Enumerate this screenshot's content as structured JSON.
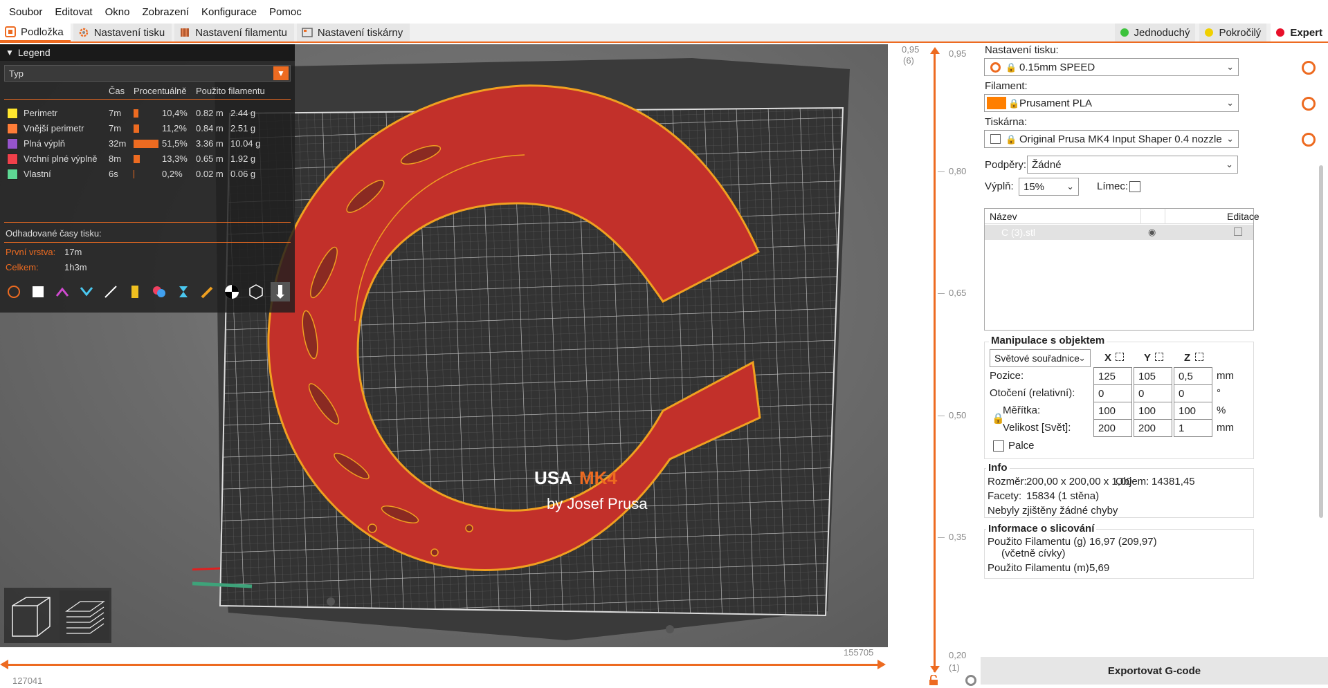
{
  "menu": [
    "Soubor",
    "Editovat",
    "Okno",
    "Zobrazení",
    "Konfigurace",
    "Pomoc"
  ],
  "tabs": [
    {
      "label": "Podložka",
      "icon": "plater-icon"
    },
    {
      "label": "Nastavení tisku",
      "icon": "gear-icon"
    },
    {
      "label": "Nastavení filamentu",
      "icon": "spool-icon"
    },
    {
      "label": "Nastavení tiskárny",
      "icon": "printer-icon"
    }
  ],
  "modes": [
    {
      "label": "Jednoduchý",
      "color": "#3cc23c"
    },
    {
      "label": "Pokročilý",
      "color": "#f0d000"
    },
    {
      "label": "Expert",
      "color": "#e8102a"
    }
  ],
  "legend": {
    "title": "Legend",
    "view_type": "Typ",
    "col_time": "Čas",
    "col_percent": "Procentuálně",
    "col_used": "Použito filamentu",
    "rows": [
      {
        "name": "Perimetr",
        "color": "#ffe62e",
        "time": "7m",
        "percent": "10,4%",
        "pct_value": 10.4,
        "m": "0.82 m",
        "g": "2.44 g"
      },
      {
        "name": "Vnější perimetr",
        "color": "#ff7d38",
        "time": "7m",
        "percent": "11,2%",
        "pct_value": 11.2,
        "m": "0.84 m",
        "g": "2.51 g"
      },
      {
        "name": "Plná výplň",
        "color": "#9654cc",
        "time": "32m",
        "percent": "51,5%",
        "pct_value": 51.5,
        "m": "3.36 m",
        "g": "10.04 g"
      },
      {
        "name": "Vrchní plné výplně",
        "color": "#f0404a",
        "time": "8m",
        "percent": "13,3%",
        "pct_value": 13.3,
        "m": "0.65 m",
        "g": "1.92 g"
      },
      {
        "name": "Vlastní",
        "color": "#5ed894",
        "time": "6s",
        "percent": "0,2%",
        "pct_value": 0.2,
        "m": "0.02 m",
        "g": "0.06 g"
      }
    ],
    "est_label": "Odhadované časy tisku:",
    "first_layer_label": "První vrstva:",
    "first_layer_value": "17m",
    "total_label": "Celkem:",
    "total_value": "1h3m"
  },
  "bed_text": {
    "brand_part": "USA",
    "model": "MK4",
    "by": "by Josef Prusa"
  },
  "hslider": {
    "left_value": "127041",
    "right_value": "155705"
  },
  "vslider": {
    "top_value": "0,95",
    "top_layer": "(6)",
    "top_label": "0,95",
    "ticks": [
      "0,80",
      "0,65",
      "0,50",
      "0,35"
    ],
    "bottom_value": "0,20",
    "bottom_layer": "(1)"
  },
  "sidebar": {
    "print_label": "Nastavení tisku:",
    "print_value": "0.15mm SPEED",
    "filament_label": "Filament:",
    "filament_value": "Prusament PLA",
    "filament_color": "#ff7f00",
    "printer_label": "Tiskárna:",
    "printer_value": "Original Prusa MK4 Input Shaper 0.4 nozzle",
    "supports_label": "Podpěry:",
    "supports_value": "Žádné",
    "infill_label": "Výplň:",
    "infill_value": "15%",
    "brim_label": "Límec:",
    "objlist_col_name": "Název",
    "objlist_col_edit": "Editace",
    "object_name": "C (3).stl",
    "manip_title": "Manipulace s objektem",
    "coord_value": "Světové souřadnice",
    "axis_x": "X",
    "axis_y": "Y",
    "axis_z": "Z",
    "pos_label": "Pozice:",
    "pos": [
      "125",
      "105",
      "0,5"
    ],
    "pos_unit": "mm",
    "rot_label": "Otočení (relativní):",
    "rot": [
      "0",
      "0",
      "0"
    ],
    "rot_unit": "°",
    "scale_label": "Měřítka:",
    "scale": [
      "100",
      "100",
      "100"
    ],
    "scale_unit": "%",
    "size_label": "Velikost [Svět]:",
    "size": [
      "200",
      "200",
      "1"
    ],
    "size_unit": "mm",
    "inches_label": "Palce",
    "info_title": "Info",
    "size_info_label": "Rozměr:",
    "size_info_value": "200,00 x 200,00 x 1,00",
    "volume_label": "Objem:",
    "volume_value": "14381,45",
    "facets_label": "Facety:",
    "facets_value": "15834 (1 stěna)",
    "errors_text": "Nebyly zjištěny žádné chyby",
    "slice_title": "Informace o slicování",
    "fil_g_label": "Použito Filamentu (g)",
    "fil_g_sub": "(včetně cívky)",
    "fil_g_value": "16,97 (209,97)",
    "fil_m_label": "Použito Filamentu (m)",
    "fil_m_value": "5,69",
    "export_label": "Exportovat G-code"
  }
}
